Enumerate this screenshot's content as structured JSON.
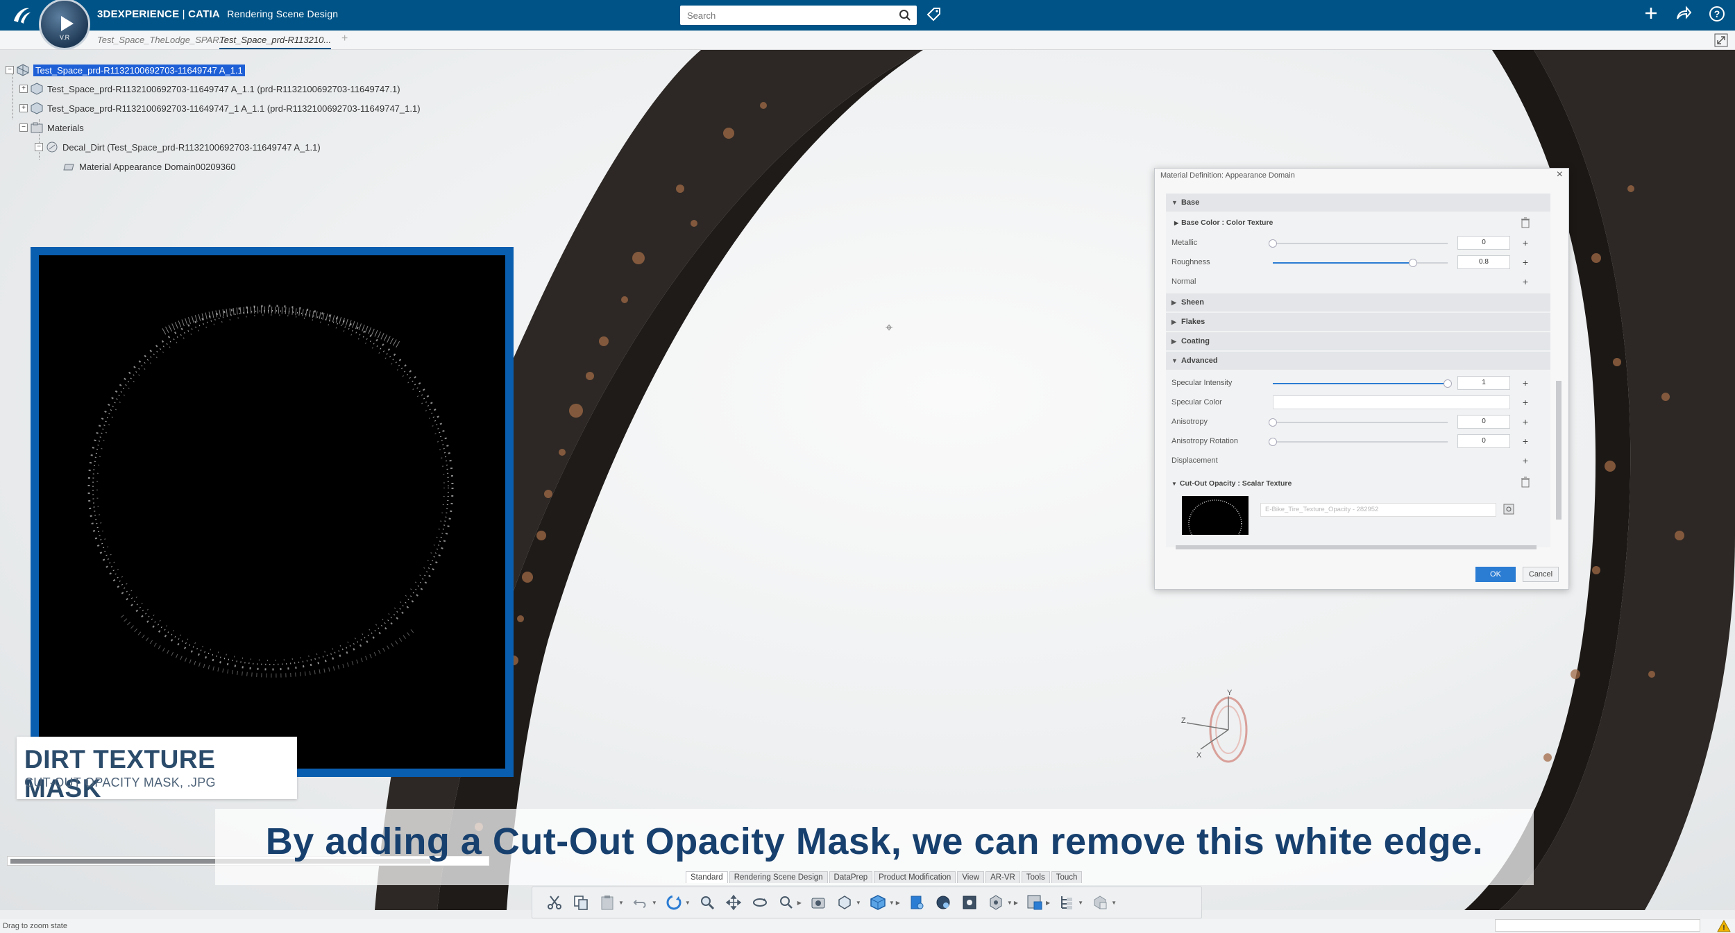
{
  "app": {
    "brand": "3DEXPERIENCE",
    "separator": "|",
    "product": "CATIA",
    "role": "Rendering Scene Design",
    "compass_version": "V.R"
  },
  "search": {
    "placeholder": "Search",
    "value": ""
  },
  "tabs": [
    {
      "label": "Test_Space_TheLodge_SPAR...",
      "active": false
    },
    {
      "label": "Test_Space_prd-R113210...",
      "active": true
    }
  ],
  "tree": {
    "items": [
      {
        "label": "Test_Space_prd-R1132100692703-11649747 A_1.1",
        "selected": true
      },
      {
        "label": "Test_Space_prd-R1132100692703-11649747 A_1.1 (prd-R1132100692703-11649747.1)"
      },
      {
        "label": "Test_Space_prd-R1132100692703-11649747_1 A_1.1 (prd-R1132100692703-11649747_1.1)"
      },
      {
        "label": "Materials"
      },
      {
        "label": "Decal_Dirt (Test_Space_prd-R1132100692703-11649747 A_1.1)"
      },
      {
        "label": "Material Appearance Domain00209360"
      }
    ]
  },
  "overlay": {
    "title": "DIRT TEXTURE MASK",
    "subtitle": "CUT-OUT OPACITY MASK, .JPG",
    "caption": "By adding a Cut-Out Opacity Mask, we can remove this white edge."
  },
  "dialog": {
    "title": "Material Definition: Appearance Domain",
    "sections": {
      "base": "Base",
      "base_color": "Base Color : Color Texture",
      "sheen": "Sheen",
      "flakes": "Flakes",
      "coating": "Coating",
      "advanced": "Advanced",
      "cutout": "Cut-Out Opacity : Scalar Texture"
    },
    "props": {
      "metallic": {
        "label": "Metallic",
        "value": "0",
        "level": 0
      },
      "roughness": {
        "label": "Roughness",
        "value": "0.8",
        "level": 0.8
      },
      "normal": {
        "label": "Normal"
      },
      "specular_intensity": {
        "label": "Specular Intensity",
        "value": "1",
        "level": 1
      },
      "specular_color": {
        "label": "Specular Color"
      },
      "anisotropy": {
        "label": "Anisotropy",
        "value": "0",
        "level": 0
      },
      "anisotropy_rotation": {
        "label": "Anisotropy Rotation",
        "value": "0",
        "level": 0
      },
      "displacement": {
        "label": "Displacement"
      }
    },
    "texture_name": "E-Bike_Tire_Texture_Opacity - 282952",
    "ok": "OK",
    "cancel": "Cancel"
  },
  "workbench_tabs": [
    "Standard",
    "Rendering Scene Design",
    "DataPrep",
    "Product Modification",
    "View",
    "AR-VR",
    "Tools",
    "Touch"
  ],
  "toolbar_icons": [
    "cut-icon",
    "copy-icon",
    "paste-icon",
    "undo-icon",
    "update-icon",
    "zoom-icon",
    "pan-icon",
    "rotate-icon",
    "zoom-area-icon",
    "capture-icon",
    "fit-all-icon",
    "view-cube-icon",
    "render-icon",
    "environment-icon",
    "lighting-icon",
    "settings-icon",
    "sequence-icon",
    "tree-icon",
    "compass-icon"
  ],
  "status": {
    "text": "Drag to zoom state"
  },
  "colors": {
    "brand_blue": "#005386",
    "accent": "#2b7cd3",
    "caption": "#17406e"
  }
}
